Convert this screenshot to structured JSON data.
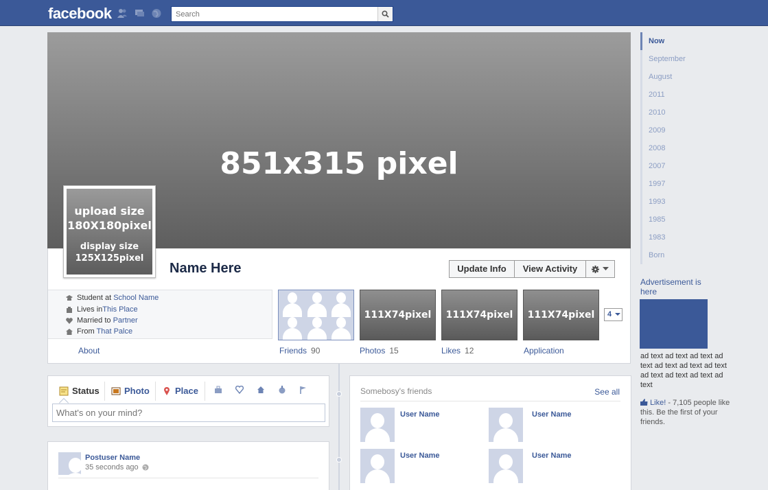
{
  "topbar": {
    "logo": "facebook",
    "search_placeholder": "Search"
  },
  "cover": {
    "label": "851x315 pixel"
  },
  "profile_pic": {
    "upload_label": "upload size",
    "upload_size": "180X180pixel",
    "display_label": "display size",
    "display_size": "125X125pixel"
  },
  "profile": {
    "name": "Name Here"
  },
  "actions": {
    "update_info": "Update Info",
    "view_activity": "View Activity"
  },
  "about": {
    "rows": [
      {
        "prefix": "Student at",
        "link": "School Name"
      },
      {
        "prefix": "Lives in",
        "link": "This Place"
      },
      {
        "prefix": "Married to",
        "link": "Partner"
      },
      {
        "prefix": "From",
        "link": "That Palce"
      }
    ],
    "label": "About"
  },
  "apps": {
    "thumb_label": "111X74pixel",
    "more_count": "4",
    "friends": {
      "label": "Friends",
      "count": "90"
    },
    "photos": {
      "label": "Photos",
      "count": "15"
    },
    "likes": {
      "label": "Likes",
      "count": "12"
    },
    "application": {
      "label": "Application"
    }
  },
  "composer": {
    "status": "Status",
    "photo": "Photo",
    "place": "Place",
    "placeholder": "What's on your mind?"
  },
  "post": {
    "user": "Postuser Name",
    "time": "35 seconds ago"
  },
  "friends_box": {
    "title": "Somebosy's friends",
    "see_all": "See all",
    "users": [
      "User Name",
      "User Name",
      "User Name",
      "User Name"
    ]
  },
  "timeline_years": [
    "Now",
    "September",
    "August",
    "2011",
    "2010",
    "2009",
    "2008",
    "2007",
    "1997",
    "1993",
    "1985",
    "1983",
    "Born"
  ],
  "ad": {
    "title": "Advertisement is here",
    "text": "ad text ad text ad text ad text ad text ad text ad text ad text ad text ad text ad text",
    "like": "Like!",
    "like_rest": " - 7,105 people like this. Be the first of your friends."
  },
  "colors": {
    "brand": "#3b5998",
    "background": "#e9ebee"
  }
}
